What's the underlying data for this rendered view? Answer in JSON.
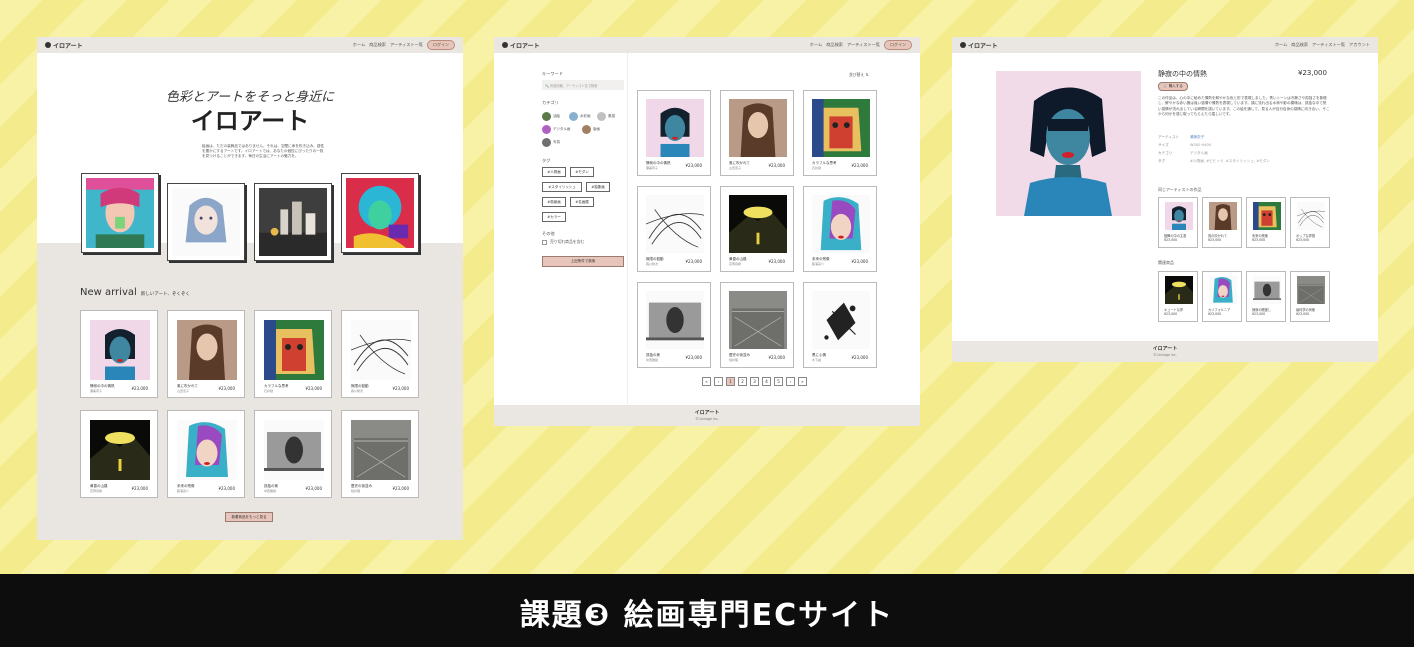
{
  "caption": "課題❸ 絵画専門ECサイト",
  "brand": "イロアート",
  "copyright": "©Carriage inc.",
  "nav": {
    "home": "ホーム",
    "search": "商品検索",
    "artists": "アーティスト一覧",
    "login": "ログイン",
    "account": "アカウント"
  },
  "top": {
    "hero_sub": "色彩とアートをそっと身近に",
    "hero_title": "イロアート",
    "hero_desc": "絵画は、ただの装飾品ではありません。それは、空間に命を吹き込み、感性を豊かにするアートです。イロアートでは、あなたの個性にぴったりの一枚を見つけることができます。毎日の生活にアートの魅力を。",
    "new_arrival": "New arrival",
    "new_arrival_sub": "新しいアート、ぞくぞく",
    "more_button": "新着商品をもっと見る",
    "products": [
      {
        "title": "静寂の中の情熱",
        "artist": "瀬美奈子",
        "price": "¥23,000"
      },
      {
        "title": "風に吹かれて",
        "artist": "山田恵子",
        "price": "¥23,000"
      },
      {
        "title": "カラフルな思考",
        "artist": "石井健",
        "price": "¥23,000"
      },
      {
        "title": "無限の鼓動",
        "artist": "森川隆次",
        "price": "¥23,000"
      },
      {
        "title": "黄昏の山路",
        "artist": "花岡真希",
        "price": "¥23,000"
      },
      {
        "title": "未来の残像",
        "artist": "藤浦亮介",
        "price": "¥23,000"
      },
      {
        "title": "孤独の美",
        "artist": "中西雅樹",
        "price": "¥23,000"
      },
      {
        "title": "歴史の街並み",
        "artist": "桃井理",
        "price": "¥23,000"
      }
    ]
  },
  "search_page": {
    "keyword_label": "キーワード",
    "keyword_placeholder": "作品情報、アーティスト名で検索",
    "category_label": "カテゴリ",
    "categories": [
      "油絵",
      "水彩画",
      "素描",
      "デジタル画",
      "版画",
      "写真"
    ],
    "tag_label": "タグ",
    "tags": [
      "#人物画",
      "#モダン",
      "#スタイリッシュ",
      "#抽象画",
      "#風景画",
      "#名画展",
      "#カラー"
    ],
    "other_label": "その他",
    "sold_out_label": "売り切れ商品を含む",
    "search_button": "上記条件で検索",
    "sort_label": "並び替え",
    "products": [
      {
        "title": "静寂の中の情熱",
        "artist": "瀬美奈子",
        "price": "¥23,000"
      },
      {
        "title": "風に吹かれて",
        "artist": "山田恵子",
        "price": "¥23,000"
      },
      {
        "title": "カラフルな思考",
        "artist": "石井健",
        "price": "¥23,000"
      },
      {
        "title": "無限の鼓動",
        "artist": "森川隆次",
        "price": "¥23,000"
      },
      {
        "title": "黄昏の山路",
        "artist": "花岡真希",
        "price": "¥23,000"
      },
      {
        "title": "未来の残像",
        "artist": "藤浦亮介",
        "price": "¥23,000"
      },
      {
        "title": "孤独の美",
        "artist": "中西雅樹",
        "price": "¥23,000"
      },
      {
        "title": "歴史の街並み",
        "artist": "桃井理",
        "price": "¥23,000"
      },
      {
        "title": "黒に心情",
        "artist": "木下誠",
        "price": "¥23,000"
      }
    ],
    "pager": [
      "«",
      "‹",
      "1",
      "2",
      "3",
      "4",
      "5",
      "›",
      "»"
    ]
  },
  "detail": {
    "title": "静寂の中の情熱",
    "price": "¥23,000",
    "cart_button": "購入する",
    "description": "この作品は、心の中に秘めた情熱を鮮やかな色と形で表現しました。青いトーンは冷静さや孤独さを象徴し、鮮やかな赤い唇は強い感情や情熱を表現しています。顔に流れ出る水滴や影の模様は、孤独な中で熱い感情が流れ出している瞬間を描いています。この絵を通して、見る人が自分自身の感情に向き合い、そこから何かを感じ取ってもらえたら嬉しいです。",
    "specs": [
      {
        "k": "アーティスト",
        "v": "瀬美奈子"
      },
      {
        "k": "サイズ",
        "v": "W300 H400"
      },
      {
        "k": "カテゴリ",
        "v": "デジタル画"
      },
      {
        "k": "タグ",
        "v": "#人物画, #ビビッド, #スタイリッシュ, #モダン"
      }
    ],
    "same_artist_label": "同じアーティストの作品",
    "same_artist": [
      {
        "title": "鼓舞の中の主張",
        "price": "¥23,000"
      },
      {
        "title": "風の吹かれて",
        "price": "¥23,000"
      },
      {
        "title": "未来の残像",
        "price": "¥23,000"
      },
      {
        "title": "ポップな夢想",
        "price": "¥23,000"
      }
    ],
    "related_label": "関連商品",
    "related": [
      {
        "title": "キュートな夢",
        "price": "¥23,000"
      },
      {
        "title": "カリフォルニア",
        "price": "¥23,000"
      },
      {
        "title": "静寂の眼差し",
        "price": "¥23,000"
      },
      {
        "title": "幾何学の肖像",
        "price": "¥23,000"
      }
    ]
  },
  "colors": {
    "accent": "#e7c5bb",
    "nav_bg": "#eae7e2",
    "stripe_light": "#f8f2a6",
    "stripe_dark": "#f4eb8c"
  }
}
